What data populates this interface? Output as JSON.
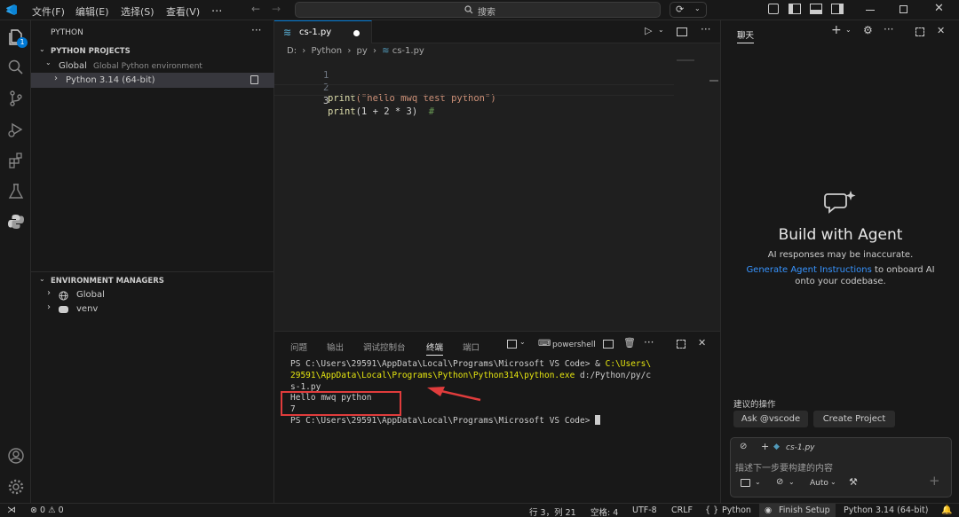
{
  "titlebar": {
    "menu": [
      "文件(F)",
      "编辑(E)",
      "选择(S)",
      "查看(V)"
    ],
    "more": "...",
    "search_placeholder": "搜索"
  },
  "activity": {
    "explorer_badge": "1"
  },
  "sidebar": {
    "title": "PYTHON",
    "section1": "PYTHON PROJECTS",
    "global_label": "Global",
    "global_desc": "Global Python environment",
    "python_item": "Python 3.14 (64-bit)",
    "section2": "ENVIRONMENT MANAGERS",
    "env_global": "Global",
    "env_venv": "venv"
  },
  "editor": {
    "tab_name": "cs-1.py",
    "breadcrumb": [
      "D:",
      "Python",
      "py",
      "cs-1.py"
    ],
    "lines": [
      {
        "num": "1",
        "text": ""
      },
      {
        "num": "2",
        "fn": "print",
        "args": "(\"hello mwq test python\")"
      },
      {
        "num": "3",
        "fn": "print",
        "args": "(1 + 2 * 3)",
        "comment": "  #"
      }
    ]
  },
  "panel": {
    "tabs": [
      "问题",
      "输出",
      "调试控制台",
      "终端",
      "端口"
    ],
    "active_tab": "终端",
    "shell_name": "powershell",
    "terminal": {
      "l1_prompt": "PS C:\\Users\\29591\\AppData\\Local\\Programs\\Microsoft VS Code> & ",
      "l1_path": "C:\\Users\\",
      "l2_path": "29591\\AppData\\Local\\Programs\\Python\\Python314\\python.exe",
      "l2_arg": " d:/Python/py/c",
      "l3": "s-1.py",
      "l4": "Hello mwq python",
      "l5": "7",
      "l6": "PS C:\\Users\\29591\\AppData\\Local\\Programs\\Microsoft VS Code> "
    }
  },
  "chat": {
    "tab": "聊天",
    "heading": "Build with Agent",
    "warning": "AI responses may be inaccurate.",
    "link": "Generate Agent Instructions",
    "link_suffix": " to onboard AI",
    "line3": "onto your codebase.",
    "suggest_label": "建议的操作",
    "btn_ask": "Ask @vscode",
    "btn_create": "Create Project",
    "context_file": "cs-1.py",
    "input_placeholder": "描述下一步要构建的内容",
    "mode": "Auto"
  },
  "statusbar": {
    "errors": "0",
    "warnings": "0",
    "position": "行 3，列 21",
    "spaces": "空格: 4",
    "encoding": "UTF-8",
    "eol": "CRLF",
    "braces": "{ }",
    "language": "Python",
    "finish": "Finish Setup",
    "interpreter": "Python 3.14 (64-bit)"
  },
  "colors": {
    "accent": "#0078d4",
    "string": "#ce9178",
    "function": "#dcdcaa",
    "comment": "#6a9955",
    "terminal_path": "#e5e510",
    "annotation_red": "#e03c3c"
  }
}
